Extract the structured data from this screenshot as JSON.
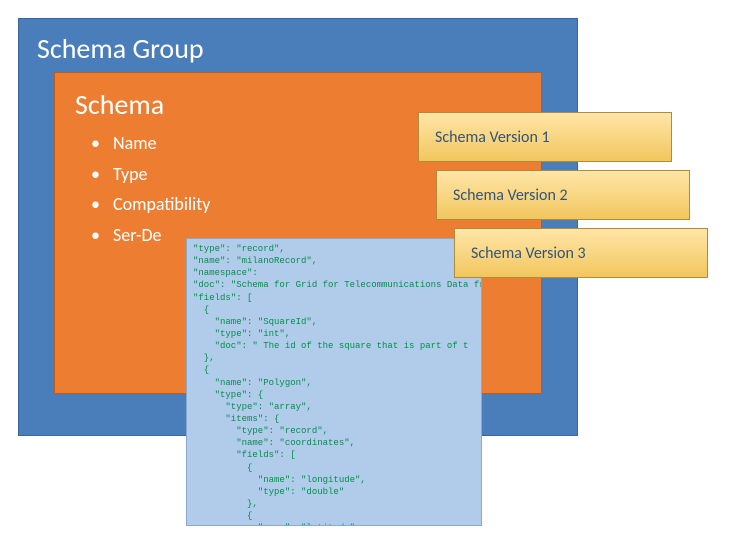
{
  "group": {
    "title": "Schema Group"
  },
  "schema": {
    "title": "Schema",
    "items": [
      "Name",
      "Type",
      "Compatibility",
      "Ser-De"
    ]
  },
  "versions": {
    "v1": "Schema Version 1",
    "v2": "Schema Version 2",
    "v3": "Schema Version 3"
  },
  "code": "\"type\": \"record\",\n\"name\": \"milanoRecord\",\n\"namespace\":\n\"doc\": \"Schema for Grid for Telecommunications Data from Te\n\"fields\": [\n  {\n    \"name\": \"SquareId\",\n    \"type\": \"int\",\n    \"doc\": \" The id of the square that is part of t\n  },\n  {\n    \"name\": \"Polygon\",\n    \"type\": {\n      \"type\": \"array\",\n      \"items\": {\n        \"type\": \"record\",\n        \"name\": \"coordinates\",\n        \"fields\": [\n          {\n            \"name\": \"longitude\",\n            \"type\": \"double\"\n          },\n          {\n            \"name\": \"latitude\",\n            \"type\": \"double\"\n          }\n        ]\n      }\n    }\n  }\n]"
}
